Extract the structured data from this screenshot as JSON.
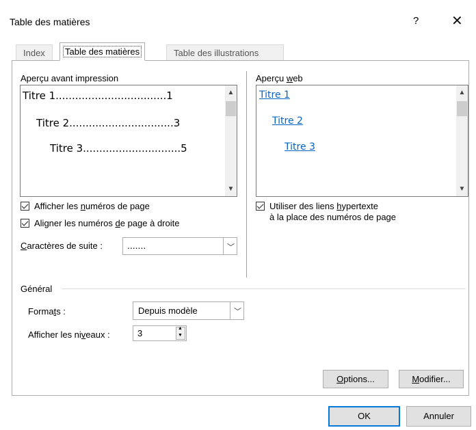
{
  "dialog": {
    "title": "Table des matières",
    "help_label": "?",
    "close_label": "✕"
  },
  "tabs": [
    {
      "label": "Index"
    },
    {
      "label": "Table des matières",
      "selected": true
    },
    {
      "label": "Table des illustrations"
    }
  ],
  "print_preview": {
    "label": "Aperçu avant impression",
    "lines": [
      "Titre 1..................................1",
      "Titre 2................................3",
      "Titre 3..............................5"
    ]
  },
  "web_preview": {
    "label_pre": "Aperçu ",
    "label_key": "w",
    "label_post": "eb",
    "links": [
      "Titre 1",
      "Titre 2",
      "Titre 3"
    ]
  },
  "options": {
    "show_page_numbers": {
      "pre": "Afficher les ",
      "key": "n",
      "post": "uméros de page",
      "checked": true
    },
    "align_right": {
      "pre": "Aligner les numéros ",
      "key": "d",
      "post": "e page à droite",
      "checked": true
    },
    "use_hyperlinks": {
      "line1_pre": "Utiliser des liens ",
      "line1_key": "h",
      "line1_post": "ypertexte",
      "line2": "à la place des numéros de page",
      "checked": true
    },
    "leader": {
      "label_key": "C",
      "label_post": "aractères de suite :",
      "value": "......."
    }
  },
  "general": {
    "heading": "Général",
    "formats_label_pre": "Forma",
    "formats_label_key": "t",
    "formats_label_post": "s :",
    "formats_value": "Depuis modèle",
    "levels_label_pre": "Afficher les ni",
    "levels_label_key": "v",
    "levels_label_post": "eaux :",
    "levels_value": "3"
  },
  "buttons": {
    "options_key": "O",
    "options_post": "ptions...",
    "modify_key": "M",
    "modify_post": "odifier...",
    "ok": "OK",
    "cancel": "Annuler"
  }
}
